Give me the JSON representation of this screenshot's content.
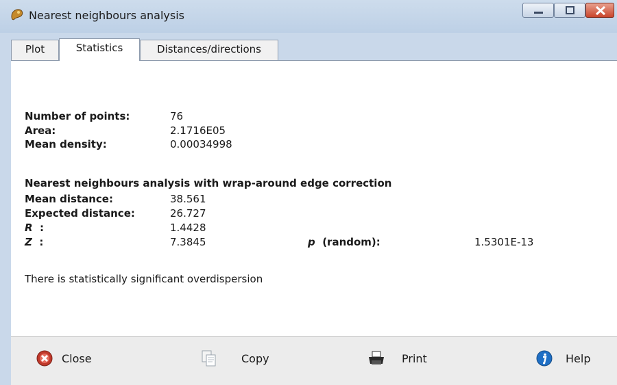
{
  "window": {
    "title": "Nearest neighbours analysis",
    "controls": [
      "minimize",
      "maximize",
      "close"
    ]
  },
  "tabs": [
    {
      "label": "Plot",
      "active": false
    },
    {
      "label": "Statistics",
      "active": true
    },
    {
      "label": "Distances/directions",
      "active": false
    }
  ],
  "stats": {
    "num_points_label": "Number of points:",
    "num_points_value": "76",
    "area_label": "Area:",
    "area_value": "2.1716E05",
    "density_label": "Mean density:",
    "density_value": "0.00034998",
    "section_header": "Nearest neighbours analysis with wrap-around edge correction",
    "mean_distance_label": "Mean distance:",
    "mean_distance_value": "38.561",
    "expected_distance_label": "Expected distance:",
    "expected_distance_value": "26.727",
    "r_label": "R",
    "r_sep": ":",
    "r_value": "1.4428",
    "z_label": "Z",
    "z_sep": ":",
    "z_value": "7.3845",
    "p_label": "p",
    "p_suffix": "(random):",
    "p_value": "1.5301E-13",
    "conclusion": "There is statistically significant overdispersion"
  },
  "buttons": {
    "close_label": "Close",
    "copy_label": "Copy",
    "print_label": "Print",
    "help_label": "Help"
  },
  "icons": {
    "app": "app-icon",
    "close": "close-x-icon",
    "copy": "copy-icon",
    "print": "printer-icon",
    "help": "info-icon"
  },
  "colors": {
    "title_bar": "#c9d8ea",
    "close_button": "#c9452c",
    "help_icon": "#1f6fc5",
    "close_icon": "#c0392b"
  }
}
